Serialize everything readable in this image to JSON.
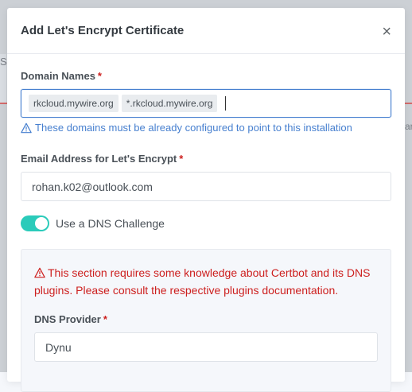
{
  "background": {
    "left_text": "SS",
    "right_text": "ar"
  },
  "modal": {
    "title": "Add Let's Encrypt Certificate",
    "close_glyph": "×",
    "domains": {
      "label": "Domain Names",
      "required_mark": "*",
      "tags": [
        "rkcloud.mywire.org",
        "*.rkcloud.mywire.org"
      ],
      "help": "These domains must be already configured to point to this installation"
    },
    "email": {
      "label": "Email Address for Let's Encrypt",
      "required_mark": "*",
      "value": "rohan.k02@outlook.com"
    },
    "dns_challenge": {
      "label": "Use a DNS Challenge",
      "enabled": true
    },
    "dns_section": {
      "warning": "This section requires some knowledge about Certbot and its DNS plugins. Please consult the respective plugins documentation.",
      "provider_label": "DNS Provider",
      "required_mark": "*",
      "provider_value": "Dynu"
    }
  },
  "colors": {
    "accent": "#467fcf",
    "toggle_on": "#2bcbba",
    "danger": "#cd201f"
  },
  "icons": {
    "close": "close-icon",
    "help": "warning-triangle-icon",
    "dns_warning": "warning-triangle-icon"
  }
}
